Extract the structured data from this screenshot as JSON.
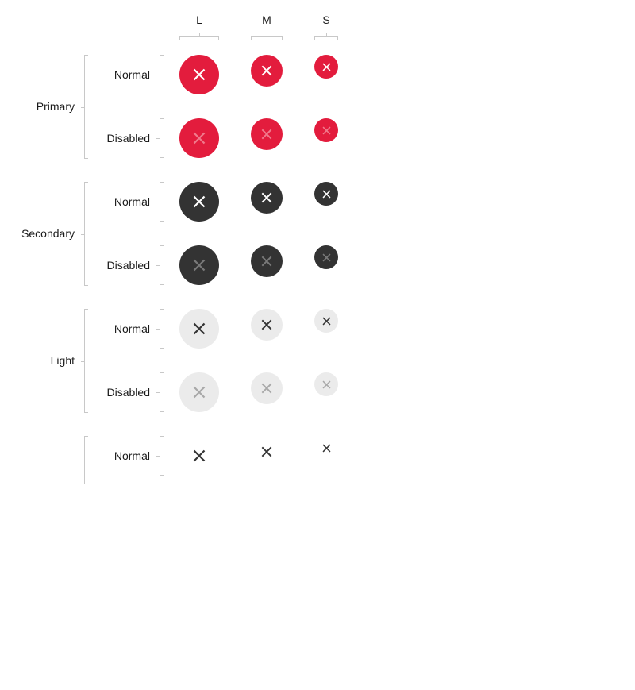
{
  "sizes": [
    "L",
    "M",
    "S"
  ],
  "variants": [
    {
      "label": "Primary",
      "key": "primary",
      "states": [
        "Normal",
        "Disabled"
      ]
    },
    {
      "label": "Secondary",
      "key": "secondary",
      "states": [
        "Normal",
        "Disabled"
      ]
    },
    {
      "label": "Light",
      "key": "light",
      "states": [
        "Normal",
        "Disabled"
      ]
    },
    {
      "label": "",
      "key": "ghost",
      "states": [
        "Normal"
      ]
    }
  ],
  "icon": "close-icon",
  "colors": {
    "primary": "#e31c3d",
    "secondary": "#333333",
    "light": "#ebebeb",
    "icon_dark": "#333333",
    "icon_light": "#ffffff",
    "bracket": "#c8c8c8"
  }
}
